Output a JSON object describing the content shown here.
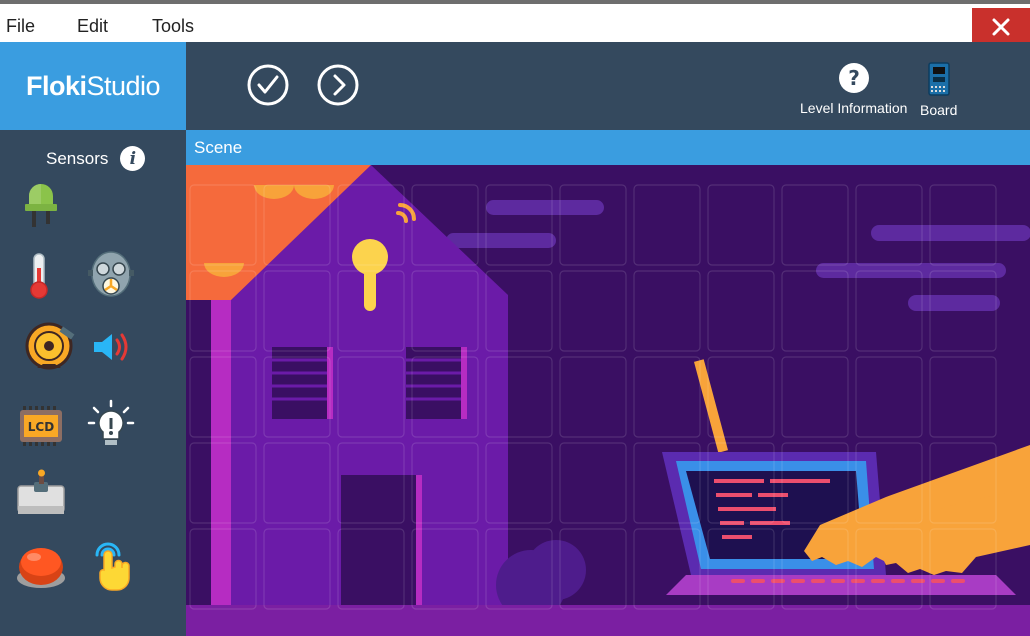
{
  "menu": {
    "file": "File",
    "edit": "Edit",
    "tools": "Tools"
  },
  "logo": {
    "bold": "Floki",
    "light": "Studio"
  },
  "toolbar": {
    "level_info_label": "Level Information",
    "board_label": "Board"
  },
  "sidebar": {
    "title": "Sensors",
    "items": [
      {
        "icon": "led-icon"
      },
      {
        "icon": "thermometer-icon"
      },
      {
        "icon": "gas-sensor-icon"
      },
      {
        "icon": "alarm-bell-icon"
      },
      {
        "icon": "speaker-icon"
      },
      {
        "icon": "lcd-icon"
      },
      {
        "icon": "light-bulb-icon"
      },
      {
        "icon": "joystick-icon"
      },
      {
        "icon": "push-button-icon"
      },
      {
        "icon": "touch-sensor-icon"
      }
    ]
  },
  "scene": {
    "title": "Scene"
  },
  "colors": {
    "accent_blue": "#3a9de0",
    "panel_dark": "#34495e",
    "close_red": "#c9302c",
    "scene_bg": "#3a0f63"
  }
}
